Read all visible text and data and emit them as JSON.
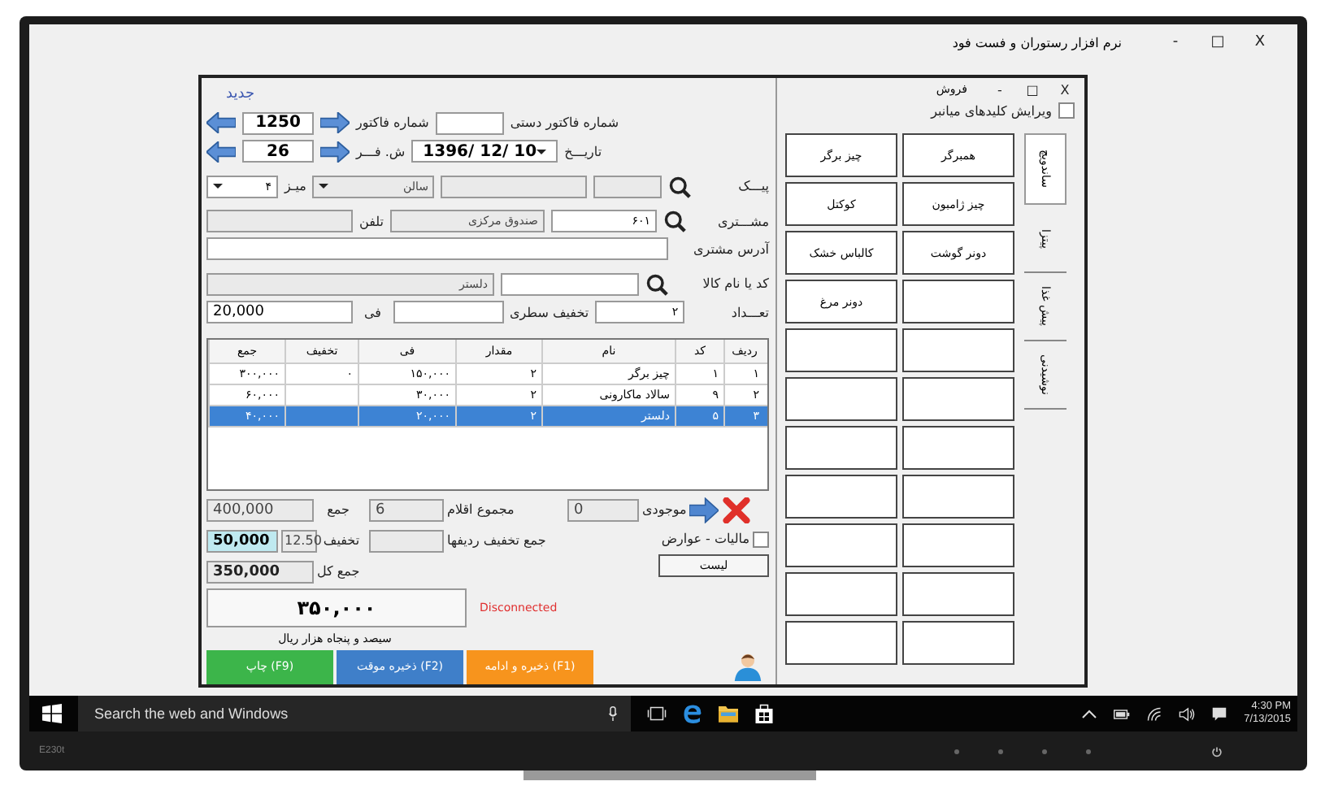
{
  "window": {
    "title": "نرم افزار رستوران و فست فود",
    "controls": [
      "X",
      "□",
      "-"
    ]
  },
  "form": {
    "new_link": "جدید",
    "invoice_number": {
      "label": "شماره فاکتور",
      "value": "1250"
    },
    "manual_invoice": {
      "label": "شماره فاکتور دستی"
    },
    "receipt_number": {
      "label": "ش. فـــر",
      "value": "26"
    },
    "date": {
      "label": "تاریـــخ",
      "value": "1396/ 12/ 10"
    },
    "courier": {
      "label": "پیـــک"
    },
    "hall": {
      "value": "سالن"
    },
    "table_no": {
      "label": "میـز",
      "value": "۴"
    },
    "customer": {
      "label": "مشـــتری",
      "code": "۶۰۱",
      "name": "صندوق مرکزی"
    },
    "phone": {
      "label": "تلفن"
    },
    "address": {
      "label": "آدرس مشتری"
    },
    "item": {
      "label": "کد یا نام کالا",
      "name": "دلستر"
    },
    "quantity": {
      "label": "تعـــداد",
      "value": "۲"
    },
    "line_discount": {
      "label": "تخفیف سطری"
    },
    "price": {
      "label": "فی",
      "value": "20,000"
    }
  },
  "table": {
    "columns": [
      "ردیف",
      "کد",
      "نام",
      "مقدار",
      "فی",
      "تخفیف",
      "جمع"
    ],
    "rows": [
      {
        "cells": [
          "۱",
          "۱",
          "چیز برگر",
          "۲",
          "۱۵۰,۰۰۰",
          "۰",
          "۳۰۰,۰۰۰"
        ],
        "selected": false
      },
      {
        "cells": [
          "۲",
          "۹",
          "سالاد ماکارونی",
          "۲",
          "۳۰,۰۰۰",
          "",
          "۶۰,۰۰۰"
        ],
        "selected": false
      },
      {
        "cells": [
          "۳",
          "۵",
          "دلستر",
          "۲",
          "۲۰,۰۰۰",
          "",
          "۴۰,۰۰۰"
        ],
        "selected": true
      }
    ]
  },
  "totals": {
    "sum": {
      "label": "جمع",
      "value": "400,000"
    },
    "discount": {
      "label": "تخفیف",
      "value": "50,000",
      "percent": "12.50"
    },
    "grand_total": {
      "label": "جمع کل",
      "value": "350,000"
    },
    "big_total": "۳۵۰,۰۰۰",
    "in_words": "سیصد و پنجاه هزار ریال",
    "item_count": {
      "label": "مجموع اقلام",
      "value": "6"
    },
    "row_discounts": {
      "label": "جمع تخفیف ردیفها"
    },
    "balance": {
      "label": "موجودی",
      "value": "0"
    },
    "status": "Disconnected",
    "tax": {
      "label": "مالیات - عوارض",
      "checked": false
    },
    "list_button": "لیست"
  },
  "buttons": [
    {
      "label": "ذخیره و ادامه (F1)",
      "color": "#f7941d"
    },
    {
      "label": "ذخیره موقت (F2)",
      "color": "#3f7fc9"
    },
    {
      "label": "چاپ (F9)",
      "color": "#3cb54a"
    }
  ],
  "panel": {
    "title": "فروش",
    "controls": [
      "X",
      "□",
      "-"
    ],
    "edit_shortcuts": {
      "label": "ویرایش کلیدهای میانبر",
      "checked": false
    },
    "tabs": [
      {
        "label": "ساندویچ",
        "selected": true
      },
      {
        "label": "پیتزا",
        "selected": false
      },
      {
        "label": "پیش غذا",
        "selected": false
      },
      {
        "label": "نوشیدنی",
        "selected": false
      }
    ],
    "menu_rows": [
      {
        "right": "همبرگر",
        "left": "چیز برگر"
      },
      {
        "right": "چیز ژامبون",
        "left": "کوکتل"
      },
      {
        "right": "دونر گوشت",
        "left": "کالباس خشک"
      },
      {
        "left": "دونر مرغ"
      }
    ]
  },
  "taskbar": {
    "search_placeholder": "Search the web and Windows",
    "time": "4:30 PM",
    "date": "7/13/2015"
  },
  "monitor": {
    "model": "E230t"
  }
}
